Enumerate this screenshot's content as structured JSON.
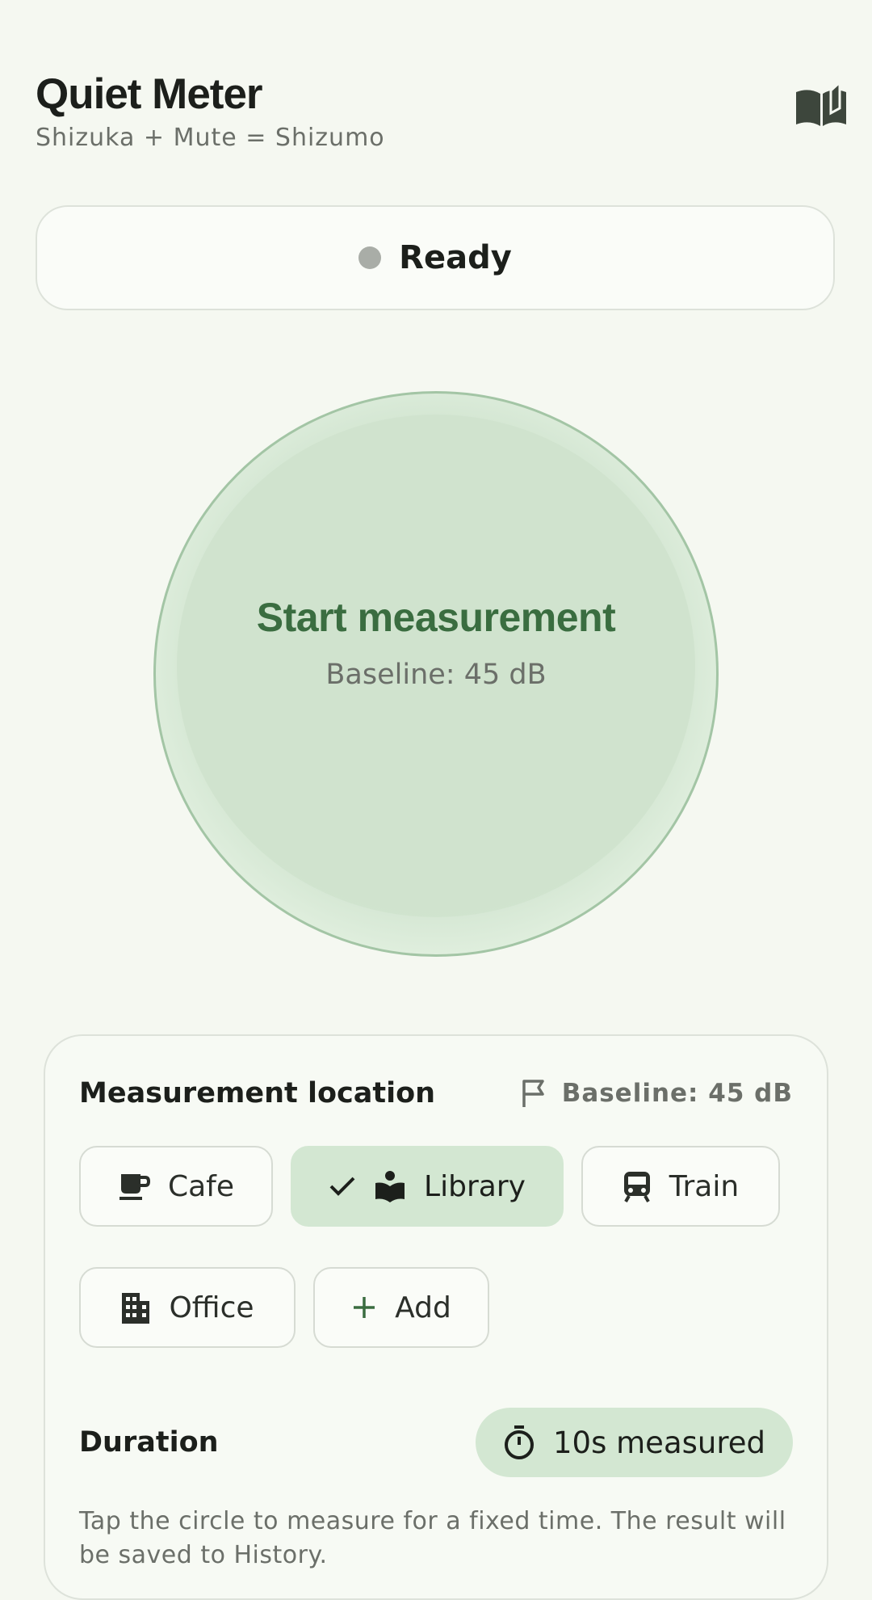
{
  "header": {
    "title": "Quiet Meter",
    "subtitle": "Shizuka + Mute = Shizumo",
    "guide_icon": "open-book-icon"
  },
  "status": {
    "text": "Ready",
    "dot_color": "#a9ada7"
  },
  "meter": {
    "title": "Start measurement",
    "baseline": "Baseline: 45 dB",
    "accent": "#3a6d40"
  },
  "location": {
    "label": "Measurement location",
    "baseline": "Baseline: 45 dB",
    "chips": [
      {
        "label": "Cafe",
        "icon": "coffee-cup-icon",
        "selected": false
      },
      {
        "label": "Library",
        "icon": "book-reader-icon",
        "selected": true
      },
      {
        "label": "Train",
        "icon": "train-icon",
        "selected": false
      },
      {
        "label": "Office",
        "icon": "office-building-icon",
        "selected": false
      },
      {
        "label": "Add",
        "icon": "plus-icon",
        "selected": false
      }
    ]
  },
  "duration": {
    "label": "Duration",
    "value": "10s measured"
  },
  "hint": "Tap the circle to measure for a fixed time. The result will be saved to History."
}
